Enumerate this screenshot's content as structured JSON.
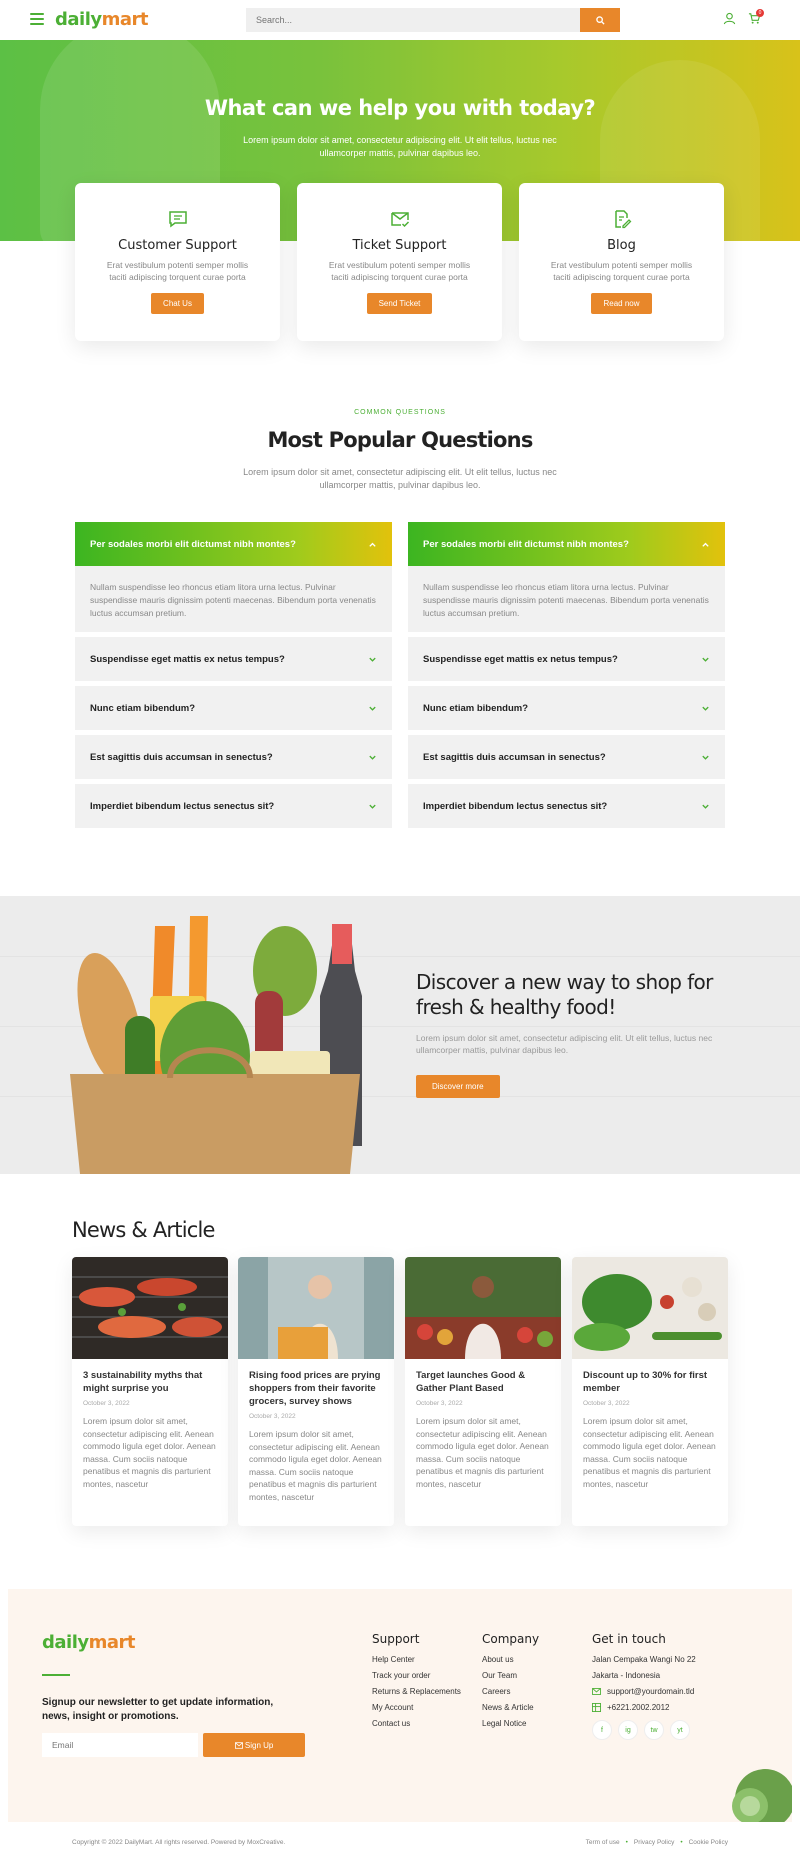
{
  "header": {
    "logo_a": "daily",
    "logo_b": "mart",
    "search_placeholder": "Search...",
    "cart_count": "0"
  },
  "hero": {
    "title": "What can we help you with today?",
    "subtitle": "Lorem ipsum dolor sit amet, consectetur adipiscing elit. Ut elit tellus, luctus nec ullamcorper mattis, pulvinar dapibus leo."
  },
  "services": [
    {
      "title": "Customer Support",
      "text": "Erat vestibulum potenti semper mollis taciti adipiscing torquent curae porta",
      "button": "Chat Us",
      "icon": "chat-icon"
    },
    {
      "title": "Ticket Support",
      "text": "Erat vestibulum potenti semper mollis taciti adipiscing torquent curae porta",
      "button": "Send Ticket",
      "icon": "mail-check-icon"
    },
    {
      "title": "Blog",
      "text": "Erat vestibulum potenti semper mollis taciti adipiscing torquent curae porta",
      "button": "Read now",
      "icon": "document-edit-icon"
    }
  ],
  "faq": {
    "eyebrow": "COMMON QUESTIONS",
    "title": "Most Popular Questions",
    "subtitle": "Lorem ipsum dolor sit amet, consectetur adipiscing elit. Ut elit tellus, luctus nec ullamcorper mattis, pulvinar dapibus leo.",
    "left": {
      "open_question": "Per sodales morbi elit dictumst nibh montes?",
      "open_answer": "Nullam suspendisse leo rhoncus etiam litora urna lectus. Pulvinar suspendisse mauris dignissim potenti maecenas. Bibendum porta venenatis luctus accumsan pretium.",
      "items": [
        "Suspendisse eget mattis ex netus tempus?",
        "Nunc etiam bibendum?",
        "Est sagittis duis accumsan in senectus?",
        "Imperdiet bibendum lectus senectus sit?"
      ]
    },
    "right": {
      "open_question": "Per sodales morbi elit dictumst nibh montes?",
      "open_answer": "Nullam suspendisse leo rhoncus etiam litora urna lectus. Pulvinar suspendisse mauris dignissim potenti maecenas. Bibendum porta venenatis luctus accumsan pretium.",
      "items": [
        "Suspendisse eget mattis ex netus tempus?",
        "Nunc etiam bibendum?",
        "Est sagittis duis accumsan in senectus?",
        "Imperdiet bibendum lectus senectus sit?"
      ]
    }
  },
  "discover": {
    "title": "Discover a new way to shop for fresh & healthy food!",
    "text": "Lorem ipsum dolor sit amet, consectetur adipiscing elit. Ut elit tellus, luctus nec ullamcorper mattis, pulvinar dapibus leo.",
    "button": "Discover more"
  },
  "news": {
    "title": "News & Article",
    "cards": [
      {
        "title": "3 sustainability myths that might surprise you",
        "date": "October 3, 2022",
        "text": "Lorem ipsum dolor sit amet, consectetur adipiscing elit. Aenean commodo ligula eget dolor. Aenean massa. Cum sociis natoque penatibus et magnis dis parturient montes, nascetur"
      },
      {
        "title": "Rising food prices are prying shoppers from their favorite grocers, survey shows",
        "date": "October 3, 2022",
        "text": "Lorem ipsum dolor sit amet, consectetur adipiscing elit. Aenean commodo ligula eget dolor. Aenean massa. Cum sociis natoque penatibus et magnis dis parturient montes, nascetur"
      },
      {
        "title": "Target launches Good & Gather Plant Based",
        "date": "October 3, 2022",
        "text": "Lorem ipsum dolor sit amet, consectetur adipiscing elit. Aenean commodo ligula eget dolor. Aenean massa. Cum sociis natoque penatibus et magnis dis parturient montes, nascetur"
      },
      {
        "title": "Discount up to 30% for first member",
        "date": "October 3, 2022",
        "text": "Lorem ipsum dolor sit amet, consectetur adipiscing elit. Aenean commodo ligula eget dolor. Aenean massa. Cum sociis natoque penatibus et magnis dis parturient montes, nascetur"
      }
    ]
  },
  "footer": {
    "newsletter": "Signup our newsletter to get update information, news, insight or promotions.",
    "email_placeholder": "Email",
    "signup": "Sign Up",
    "support": {
      "title": "Support",
      "links": [
        "Help Center",
        "Track your order",
        "Returns & Replacements",
        "My Account",
        "Contact us"
      ]
    },
    "company": {
      "title": "Company",
      "links": [
        "About us",
        "Our Team",
        "Careers",
        "News & Article",
        "Legal Notice"
      ]
    },
    "contact": {
      "title": "Get in touch",
      "address1": "Jalan Cempaka Wangi No 22",
      "address2": "Jakarta - Indonesia",
      "email": "support@yourdomain.tld",
      "phone": "+6221.2002.2012"
    },
    "social": [
      "f",
      "ig",
      "tw",
      "yt"
    ]
  },
  "bottom": {
    "copyright": "Copyright © 2022 DailyMart. All rights reserved. Powered by MoxCreative.",
    "links": [
      "Term of use",
      "Privacy Policy",
      "Cookie Policy"
    ]
  },
  "colors": {
    "brand_green": "#4caf35",
    "accent_orange": "#e8872a"
  }
}
